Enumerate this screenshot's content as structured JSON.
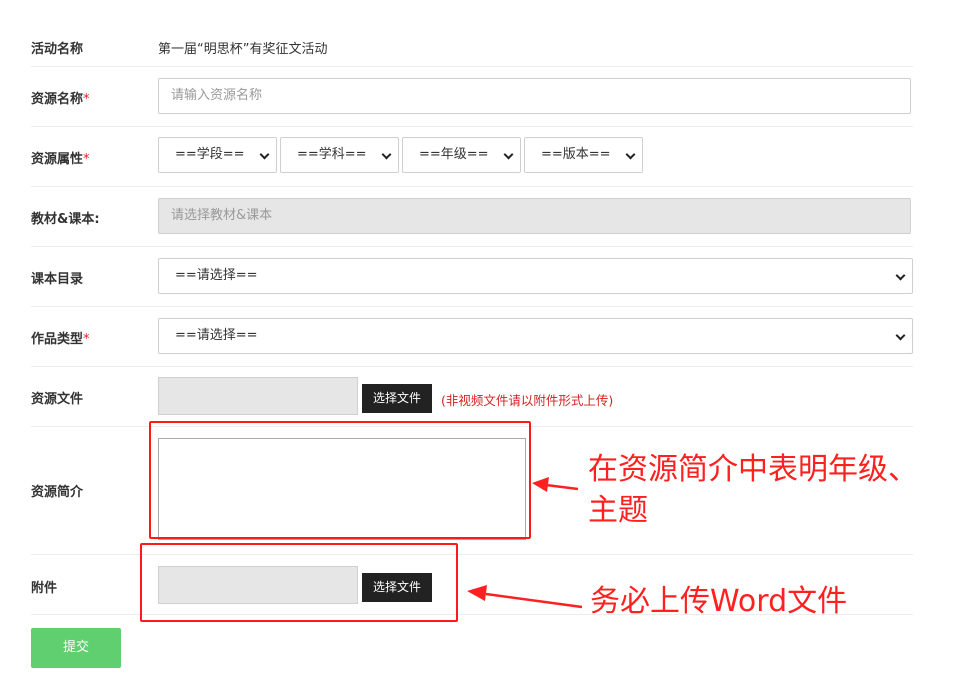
{
  "activity": {
    "label": "活动名称",
    "value": "第一届“明思杯”有奖征文活动"
  },
  "resource_name": {
    "label": "资源名称",
    "required_mark": "*",
    "placeholder": "请输入资源名称"
  },
  "resource_attr": {
    "label": "资源属性",
    "required_mark": "*",
    "selects": [
      "==学段==",
      "==学科==",
      "==年级==",
      "==版本=="
    ]
  },
  "textbook": {
    "label": "教材&课本:",
    "placeholder": "请选择教材&课本"
  },
  "catalog": {
    "label": "课本目录",
    "selected": "==请选择=="
  },
  "work_type": {
    "label": "作品类型",
    "required_mark": "*",
    "selected": "==请选择=="
  },
  "resource_file": {
    "label": "资源文件",
    "button": "选择文件",
    "note": "(非视频文件请以附件形式上传)"
  },
  "intro": {
    "label": "资源简介",
    "value": ""
  },
  "attachment": {
    "label": "附件",
    "button": "选择文件"
  },
  "submit_label": "提交",
  "annotations": {
    "intro_note_line1": "在资源简介中表明年级、",
    "intro_note_line2": "主题",
    "attachment_note": "务必上传Word文件"
  },
  "colors": {
    "annotation_red": "#ff2020",
    "submit_green": "#5fcf6f",
    "required_red": "#e02020"
  }
}
